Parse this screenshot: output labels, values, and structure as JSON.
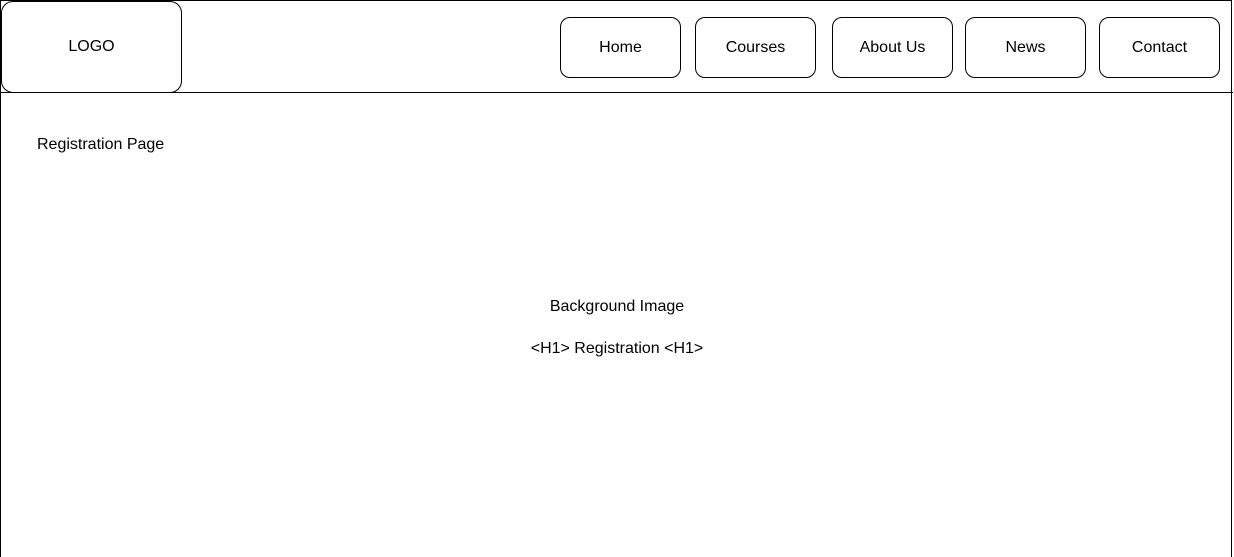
{
  "header": {
    "logo_text": "LOGO",
    "nav": [
      {
        "label": "Home"
      },
      {
        "label": "Courses"
      },
      {
        "label": "About Us"
      },
      {
        "label": "News"
      },
      {
        "label": "Contact"
      }
    ]
  },
  "main": {
    "page_label": "Registration Page",
    "background_label": "Background Image",
    "heading_placeholder": "<H1> Registration <H1>"
  }
}
